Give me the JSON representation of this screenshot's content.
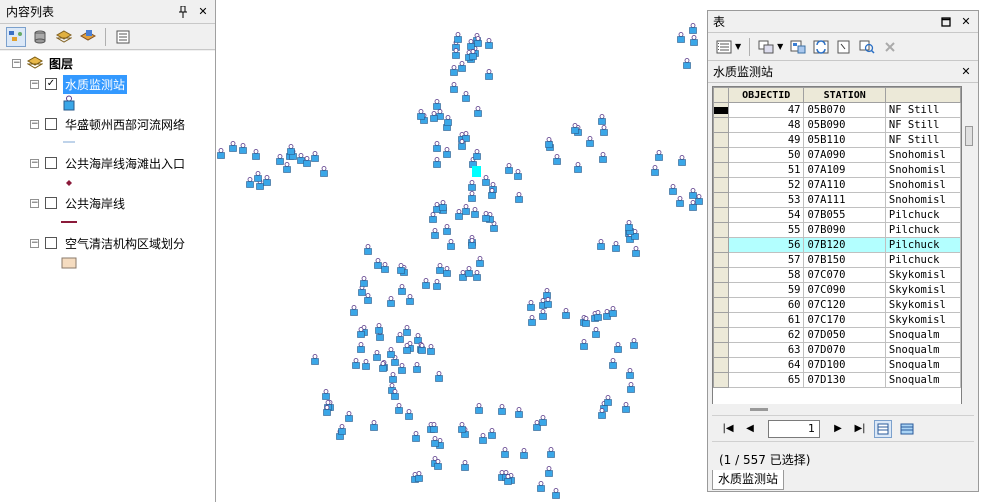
{
  "toc": {
    "title": "内容列表",
    "pin": "ᵖ",
    "close": "✕",
    "root_label": "图层",
    "layers": [
      {
        "label": "水质监测站",
        "checked": true,
        "selected": true
      },
      {
        "label": "华盛顿州西部河流网络",
        "checked": false,
        "selected": false
      },
      {
        "label": "公共海岸线海滩出入口",
        "checked": false,
        "selected": false
      },
      {
        "label": "公共海岸线",
        "checked": false,
        "selected": false
      },
      {
        "label": "空气清洁机构区域划分",
        "checked": false,
        "selected": false
      }
    ],
    "colors": {
      "selected": "#3399ff",
      "river": "#7fa7d6",
      "beach": "#8b1a3a",
      "coast": "#8b1a3a",
      "area_fill": "#f5dcc0"
    }
  },
  "table_window": {
    "title": "表",
    "table_title": "水质监测站",
    "columns": [
      "OBJECTID",
      "STATION",
      ""
    ],
    "rows": [
      {
        "id": "47",
        "station": "05B070",
        "river": "NF Still"
      },
      {
        "id": "48",
        "station": "05B090",
        "river": "NF Still"
      },
      {
        "id": "49",
        "station": "05B110",
        "river": "NF Still"
      },
      {
        "id": "50",
        "station": "07A090",
        "river": "Snohomisl"
      },
      {
        "id": "51",
        "station": "07A109",
        "river": "Snohomisl"
      },
      {
        "id": "52",
        "station": "07A110",
        "river": "Snohomisl"
      },
      {
        "id": "53",
        "station": "07A111",
        "river": "Snohomisl"
      },
      {
        "id": "54",
        "station": "07B055",
        "river": "Pilchuck"
      },
      {
        "id": "55",
        "station": "07B090",
        "river": "Pilchuck"
      },
      {
        "id": "56",
        "station": "07B120",
        "river": "Pilchuck"
      },
      {
        "id": "57",
        "station": "07B150",
        "river": "Pilchuck"
      },
      {
        "id": "58",
        "station": "07C070",
        "river": "Skykomisl"
      },
      {
        "id": "59",
        "station": "07C090",
        "river": "Skykomisl"
      },
      {
        "id": "60",
        "station": "07C120",
        "river": "Skykomisl"
      },
      {
        "id": "61",
        "station": "07C170",
        "river": "Skykomisl"
      },
      {
        "id": "62",
        "station": "07D050",
        "river": "Snoqualm"
      },
      {
        "id": "63",
        "station": "07D070",
        "river": "Snoqualm"
      },
      {
        "id": "64",
        "station": "07D100",
        "river": "Snoqualm"
      },
      {
        "id": "65",
        "station": "07D130",
        "river": "Snoqualm"
      }
    ],
    "highlight_row_id": "56",
    "page_value": "1",
    "status": "(1 / 557 已选择)",
    "bottom_tab": "水质监测站",
    "highlight_color": "#b3ffff"
  },
  "map": {
    "marker_color": "#3aa7e8",
    "marker_outline": "#5a3a8a",
    "selected_color": "#00ffff"
  }
}
